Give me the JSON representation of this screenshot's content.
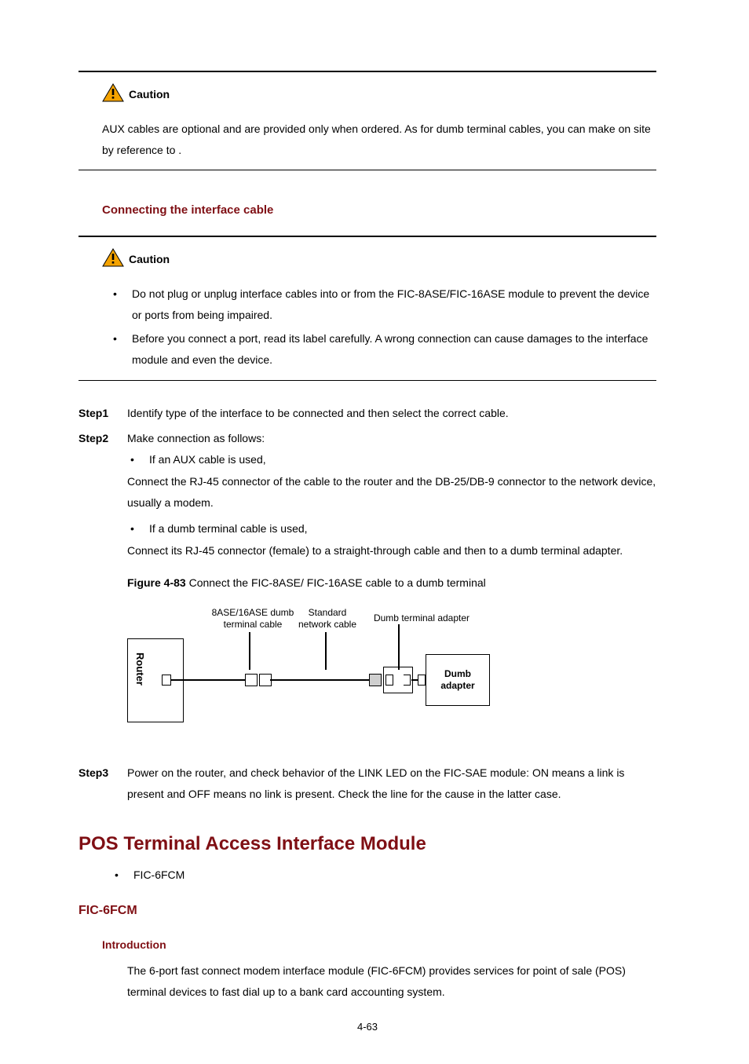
{
  "caution1": {
    "label": "Caution",
    "text_a": "AUX cables are optional and are provided only when ordered. As for dumb terminal cables, you can make on site by reference to ",
    "ref": "",
    "text_b": "."
  },
  "h3_connecting": "Connecting the interface cable",
  "caution2": {
    "label": "Caution",
    "bullets": [
      "Do not plug or unplug interface cables into or from the FIC-8ASE/FIC-16ASE module to prevent the device or ports from being impaired.",
      "Before you connect a port, read its label carefully. A wrong connection can cause damages to the interface module and even the device."
    ]
  },
  "steps": {
    "s1": {
      "label": "Step1",
      "text": "Identify type of the interface to be connected and then select the correct cable."
    },
    "s2": {
      "label": "Step2",
      "text": "Make connection as follows:",
      "b1": "If an AUX cable is used,",
      "p1": "Connect the RJ-45 connector of the cable to the router and the DB-25/DB-9 connector to the network device, usually a modem.",
      "b2": "If a dumb terminal cable is used,",
      "p2": "Connect its RJ-45 connector (female) to a straight-through cable and then to a dumb terminal adapter."
    },
    "s3": {
      "label": "Step3",
      "text": "Power on the router, and check behavior of the LINK LED on the FIC-SAE module: ON means a link is present and OFF means no link is present. Check the line for the cause in the latter case."
    }
  },
  "figure": {
    "label": "Figure 4-83",
    "caption": " Connect the FIC-8ASE/ FIC-16ASE cable to a dumb terminal",
    "labels": {
      "tcable": "8ASE/16ASE dumb\nterminal cable",
      "ncable": "Standard\nnetwork cable",
      "adapter_top": "Dumb terminal adapter",
      "router": "Router",
      "dumb": "Dumb\nadapter"
    }
  },
  "h1_pos": "POS Terminal Access Interface Module",
  "pos_bullet": "FIC-6FCM",
  "h2_fic": "FIC-6FCM",
  "h4_intro": "Introduction",
  "intro_text": "The 6-port fast connect modem interface module (FIC-6FCM) provides services for point of sale (POS) terminal devices to fast dial up to a bank card accounting system.",
  "page_num": "4-63"
}
